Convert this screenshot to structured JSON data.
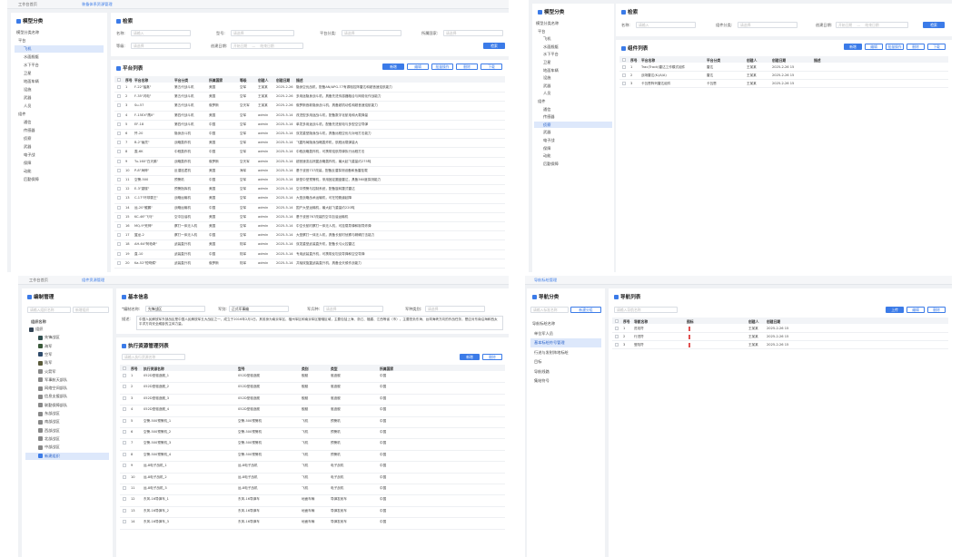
{
  "win1": {
    "tabs": [
      "工作台首页",
      "装备体系资源管理"
    ],
    "tree_title": "模型分类",
    "tree_items": [
      "模型分类名称",
      "平台",
      "飞机",
      "水面舰艇",
      "水下平台",
      "卫星",
      "地面车辆",
      "设施",
      "武器",
      "人员",
      "组件",
      "通信",
      "传感器",
      "侦察",
      "武器",
      "电子战",
      "保障",
      "动能",
      "后勤保障"
    ],
    "search": {
      "title": "检索",
      "name_label": "名称:",
      "name_ph": "请输入",
      "model_label": "型号:",
      "model_ph": "请选择",
      "cat_label": "平台分类:",
      "cat_ph": "请选择",
      "country_label": "所属国家:",
      "country_ph": "请选择",
      "level_label": "等级:",
      "level_ph": "请选择",
      "date_label": "创建日期:",
      "date_start": "开始日期",
      "date_sep": "—",
      "date_end": "结束日期",
      "search_btn": "检索"
    },
    "list": {
      "title": "平台列表",
      "buttons": [
        "新增",
        "编辑",
        "批量操作",
        "删除",
        "下载"
      ],
      "columns": [
        "序号",
        "平台名称",
        "平台分类",
        "所属国家",
        "等级",
        "创建人",
        "创建日期",
        "描述"
      ],
      "rows": [
        [
          "1",
          "F-22\"猛禽\"",
          "第五代战斗机",
          "美国",
          "空军",
          "王某某",
          "2025-2-26 15",
          "隐身空优战机，配备AN/APG-77有源相控阵雷达和超音速巡航能力"
        ],
        [
          "2",
          "F-35\"闪电\"",
          "第五代战斗机",
          "美国",
          "空军",
          "王某某",
          "2025-2-26 15",
          "多用途隐身战斗机，具备先进传感器融合与网络化作战能力"
        ],
        [
          "3",
          "Su-57",
          "第五代战斗机",
          "俄罗斯",
          "空天军",
          "王某某",
          "2025-2-26 15",
          "俄罗斯首款隐身战斗机，具备超机动性和超音速巡航能力"
        ],
        [
          "4",
          "F-15EX\"鹰II\"",
          "第四代战斗机",
          "美国",
          "空军",
          "admin",
          "2025-5-14 16",
          "改进型多用途战斗机，配备数字化航电和大载弹量"
        ],
        [
          "5",
          "EF-18",
          "第四代战斗机",
          "中国",
          "空军",
          "admin",
          "2025-5-14 16",
          "单发多用途战斗机，配备先进航电与多型空空导弹"
        ],
        [
          "6",
          "歼-20",
          "隐身战斗机",
          "中国",
          "空军",
          "admin",
          "2025-5-14 16",
          "双发重型隐身战斗机，具备远程空优与对地打击能力"
        ],
        [
          "7",
          "B-2\"幽灵\"",
          "战略轰炸机",
          "美国",
          "空军",
          "admin",
          "2025-5-14 16",
          "飞翼布局隐身战略轰炸机，航程远载弹量大"
        ],
        [
          "8",
          "轰-6K",
          "中程轰炸机",
          "中国",
          "空军",
          "admin",
          "2025-5-14 16",
          "中程战略轰炸机，可携带巡航导弹执行远程打击"
        ],
        [
          "9",
          "Tu-160\"白天鹅\"",
          "战略轰炸机",
          "俄罗斯",
          "空天军",
          "admin",
          "2025-5-14 16",
          "超音速变后掠翼战略轰炸机，最大起飞重量约275吨"
        ],
        [
          "10",
          "P-8\"海神\"",
          "反潜巡逻机",
          "美国",
          "海军",
          "admin",
          "2025-5-14 16",
          "基于波音737改装，配备反潜探测设备和鱼雷挂载"
        ],
        [
          "11",
          "空警-500",
          "预警机",
          "中国",
          "空军",
          "admin",
          "2025-5-14 16",
          "新型中型预警机，采用固定圆盘雷达，具备360度探测能力"
        ],
        [
          "12",
          "E-3\"望楼\"",
          "预警指挥机",
          "美国",
          "空军",
          "admin",
          "2025-5-14 16",
          "空中预警与控制系统，配备旋转罩式雷达"
        ],
        [
          "13",
          "C-17\"环球霸王\"",
          "战略运输机",
          "美国",
          "空军",
          "admin",
          "2025-5-14 16",
          "大型战略战术运输机，可在短跑道起降"
        ],
        [
          "14",
          "运-20\"鲲鹏\"",
          "战略运输机",
          "中国",
          "空军",
          "admin",
          "2025-5-14 16",
          "国产大型运输机，最大起飞重量约220吨"
        ],
        [
          "15",
          "KC-46\"飞马\"",
          "空中加油机",
          "美国",
          "空军",
          "admin",
          "2025-5-14 16",
          "基于波音767改装的空中加油运输机"
        ],
        [
          "16",
          "MQ-9\"死神\"",
          "察打一体无人机",
          "美国",
          "空军",
          "admin",
          "2025-5-14 16",
          "中空长航时察打一体无人机，可挂载导弹和制导炸弹"
        ],
        [
          "17",
          "翼龙-2",
          "察打一体无人机",
          "中国",
          "空军",
          "admin",
          "2025-5-14 16",
          "大型察打一体无人机，具备长航时侦察与精确打击能力"
        ],
        [
          "18",
          "AH-64\"阿帕奇\"",
          "武装直升机",
          "美国",
          "陆军",
          "admin",
          "2025-5-14 16",
          "双发重型武装直升机，配备长弓火控雷达"
        ],
        [
          "19",
          "直-10",
          "武装直升机",
          "中国",
          "陆军",
          "admin",
          "2025-5-14 16",
          "专用武装直升机，可携带反坦克导弹和空空导弹"
        ],
        [
          "20",
          "Ka-52\"短吻鳄\"",
          "武装直升机",
          "俄罗斯",
          "陆军",
          "admin",
          "2025-5-14 16",
          "共轴双旋翼武装直升机，具备全天候作战能力"
        ]
      ]
    }
  },
  "win2": {
    "tree_title": "模型分类",
    "tree_items": [
      "模型分类名称",
      "平台",
      "飞机",
      "水面舰艇",
      "水下平台",
      "卫星",
      "地面车辆",
      "设施",
      "武器",
      "人员",
      "组件",
      "通信",
      "传感器",
      "侦察",
      "武器",
      "电子战",
      "保障",
      "动能",
      "后勤保障"
    ],
    "search": {
      "title": "检索",
      "name_label": "名称:",
      "name_ph": "请输入",
      "cat_label": "组件分类:",
      "cat_ph": "请选择",
      "date_label": "创建日期:",
      "date_start": "开始日期",
      "date_sep": "—",
      "date_end": "结束日期",
      "search_btn": "检索"
    },
    "list": {
      "title": "组件列表",
      "buttons": [
        "新增",
        "编辑",
        "批量操作",
        "删除",
        "下载"
      ],
      "columns": [
        "序号",
        "平台名称",
        "平台分类",
        "创建人",
        "创建日期",
        "描述"
      ],
      "rows": [
        [
          "1",
          "Trac(Track)雷达工作模式组件",
          "雷达",
          "王某某",
          "2025-2-26 15",
          ""
        ],
        [
          "2",
          "战场雷达(K-JA/A)",
          "雷达",
          "王某某",
          "2025-2-26 15",
          ""
        ],
        [
          "3",
          "卡瓦恩阵列雷达组件",
          "卡瓦恩",
          "王某某",
          "2025-2-26 15",
          ""
        ]
      ]
    }
  },
  "win3": {
    "tabs": [
      "工作台首页",
      "组件资源管理"
    ],
    "tree_title": "编制管理",
    "tree_search_ph": "请输入组织名称",
    "tree_search_btn": "新增组织",
    "tree_header": "组织名称",
    "tree_items": [
      "组织",
      "先锋战区",
      "海军",
      "空军",
      "陆军",
      "火箭军",
      "军事航天部队",
      "网络空间部队",
      "信息支援部队",
      "联勤保障部队",
      "东部战区",
      "南部战区",
      "西部战区",
      "北部战区",
      "中部战区",
      "新建组织"
    ],
    "basic": {
      "title": "基本信息",
      "name_label": "*编制名称:",
      "name_value": "先锋战区",
      "type_label": "军别:",
      "type_value": "正式军事编",
      "cat_label": "军兵种:",
      "cat_ph": "请选择",
      "mil_label": "军种类别:",
      "mil_ph": "请选择",
      "desc_label": "描述:",
      "desc_value": "中国人民解放军东部战区是中国人民解放军五大战区之一，成立于2016年2月1日。其前身为南京军区、福州军区和南京军区管辖区域，主要包括上海、浙江、福建、江西等省（市）。主要担负东海、台湾海峡方向的作战任务，是应对东南沿海和西太平洋方向安全威胁的主体力量。"
    },
    "res": {
      "title": "执行资源管理列表",
      "search_ph": "请输入执行资源名称",
      "buttons": [
        "新增",
        "删除"
      ],
      "columns": [
        "序号",
        "执行资源名称",
        "型号",
        "类别",
        "类型",
        "所属国家"
      ],
      "rows": [
        [
          "1",
          "052D型驱逐舰_1",
          "052D型驱逐舰",
          "舰艇",
          "驱逐舰",
          "中国"
        ],
        [
          "2",
          "052D型驱逐舰_2",
          "052D型驱逐舰",
          "舰艇",
          "驱逐舰",
          "中国"
        ],
        [
          "3",
          "052D型驱逐舰_3",
          "052D型驱逐舰",
          "舰艇",
          "驱逐舰",
          "中国"
        ],
        [
          "4",
          "052D型驱逐舰_4",
          "052D型驱逐舰",
          "舰艇",
          "驱逐舰",
          "中国"
        ],
        [
          "5",
          "空警-500预警机_1",
          "空警-500预警机",
          "飞机",
          "预警机",
          "中国"
        ],
        [
          "6",
          "空警-500预警机_2",
          "空警-500预警机",
          "飞机",
          "预警机",
          "中国"
        ],
        [
          "7",
          "空警-500预警机_3",
          "空警-500预警机",
          "飞机",
          "预警机",
          "中国"
        ],
        [
          "8",
          "空警-500预警机_4",
          "空警-500预警机",
          "飞机",
          "预警机",
          "中国"
        ],
        [
          "9",
          "运-8电子战机_1",
          "运-8电子战机",
          "飞机",
          "电子战机",
          "中国"
        ],
        [
          "10",
          "运-8电子战机_2",
          "运-8电子战机",
          "飞机",
          "电子战机",
          "中国"
        ],
        [
          "11",
          "运-8电子战机_3",
          "运-8电子战机",
          "飞机",
          "电子战机",
          "中国"
        ],
        [
          "12",
          "东风-16导弹车_1",
          "东风-16导弹车",
          "地面车辆",
          "导弹发射车",
          "中国"
        ],
        [
          "13",
          "东风-16导弹车_2",
          "东风-16导弹车",
          "地面车辆",
          "导弹发射车",
          "中国"
        ],
        [
          "14",
          "东风-16导弹车_3",
          "东风-16导弹车",
          "地面车辆",
          "导弹发射车",
          "中国"
        ]
      ]
    }
  },
  "win4": {
    "tabs": [
      "导航标绘管理"
    ],
    "tree_title": "导航分类",
    "tree_search_ph": "请输入标准名称",
    "tree_search_btn": "新建分组",
    "tree_items": [
      "导航标绘名称",
      "单位军人员",
      "基本标绘符号管理",
      "行进与发射阵地标绘",
      "目标",
      "导航线路",
      "集结符号"
    ],
    "list": {
      "title": "导航列表",
      "search_ph": "请输入导航名称",
      "buttons": [
        "上传",
        "编辑",
        "删除"
      ],
      "columns": [
        "序号",
        "导航名称",
        "图标",
        "创建人",
        "创建日期"
      ],
      "rows": [
        [
          "1",
          "进攻符",
          "王某某",
          "2025-2-26 15"
        ],
        [
          "2",
          "行进符",
          "王某某",
          "2025-2-26 15"
        ],
        [
          "3",
          "登陆符",
          "王某某",
          "2025-2-26 15"
        ]
      ]
    }
  },
  "colors": {
    "accent": "#3b7be8",
    "icon_red": "#e05050"
  }
}
